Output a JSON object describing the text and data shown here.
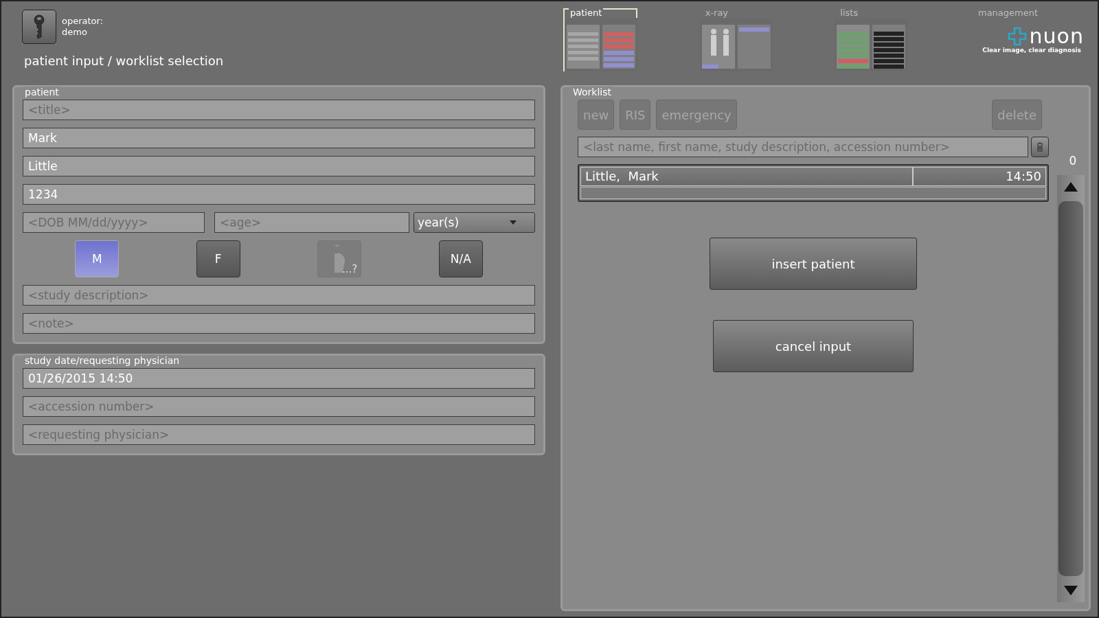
{
  "operator": {
    "label": "operator:",
    "name": "demo"
  },
  "screen_title": "patient input / worklist selection",
  "nav": [
    {
      "label": "patient",
      "kind": "thumb",
      "selected": true
    },
    {
      "label": "x-ray",
      "kind": "thumb",
      "selected": false
    },
    {
      "label": "lists",
      "kind": "thumb",
      "selected": false
    },
    {
      "label": "management",
      "kind": "logo",
      "selected": false,
      "logo": "nuon",
      "tagline": "Clear image, clear diagnosis"
    }
  ],
  "patient": {
    "legend": "patient",
    "fields": [
      {
        "placeholder": "<title>"
      },
      {
        "value": "Mark"
      },
      {
        "value": "Little"
      },
      {
        "value": "1234"
      }
    ],
    "dob": {
      "placeholder": "<DOB MM/dd/yyyy>"
    },
    "age": {
      "placeholder": "<age>"
    },
    "age_unit": "year(s)",
    "sex_buttons": [
      {
        "kind": "text",
        "label": "M",
        "selected": true,
        "disabled": false
      },
      {
        "kind": "text",
        "label": "F",
        "selected": false,
        "disabled": false
      },
      {
        "kind": "pregnant",
        "label": "...?",
        "selected": false,
        "disabled": true
      },
      {
        "kind": "text",
        "label": "N/A",
        "selected": false,
        "disabled": false
      }
    ],
    "extra_fields": [
      {
        "placeholder": "<study description>"
      },
      {
        "placeholder": "<note>"
      }
    ]
  },
  "study": {
    "legend": "study date/requesting physician",
    "fields": [
      {
        "value": "01/26/2015 14:50"
      },
      {
        "placeholder": "<accession number>"
      },
      {
        "placeholder": "<requesting physician>"
      }
    ]
  },
  "worklist": {
    "legend": "Worklist",
    "buttons": [
      {
        "label": "new",
        "disabled": true
      },
      {
        "label": "RIS",
        "disabled": true
      },
      {
        "label": "emergency",
        "disabled": true
      }
    ],
    "delete_button": {
      "label": "delete",
      "disabled": true
    },
    "search": {
      "placeholder": "<last name, first name, study description, accession number>"
    },
    "count": "0",
    "rows": [
      {
        "name": "Little,  Mark",
        "time": "14:50"
      }
    ],
    "actions": [
      "insert patient",
      "cancel input"
    ]
  }
}
